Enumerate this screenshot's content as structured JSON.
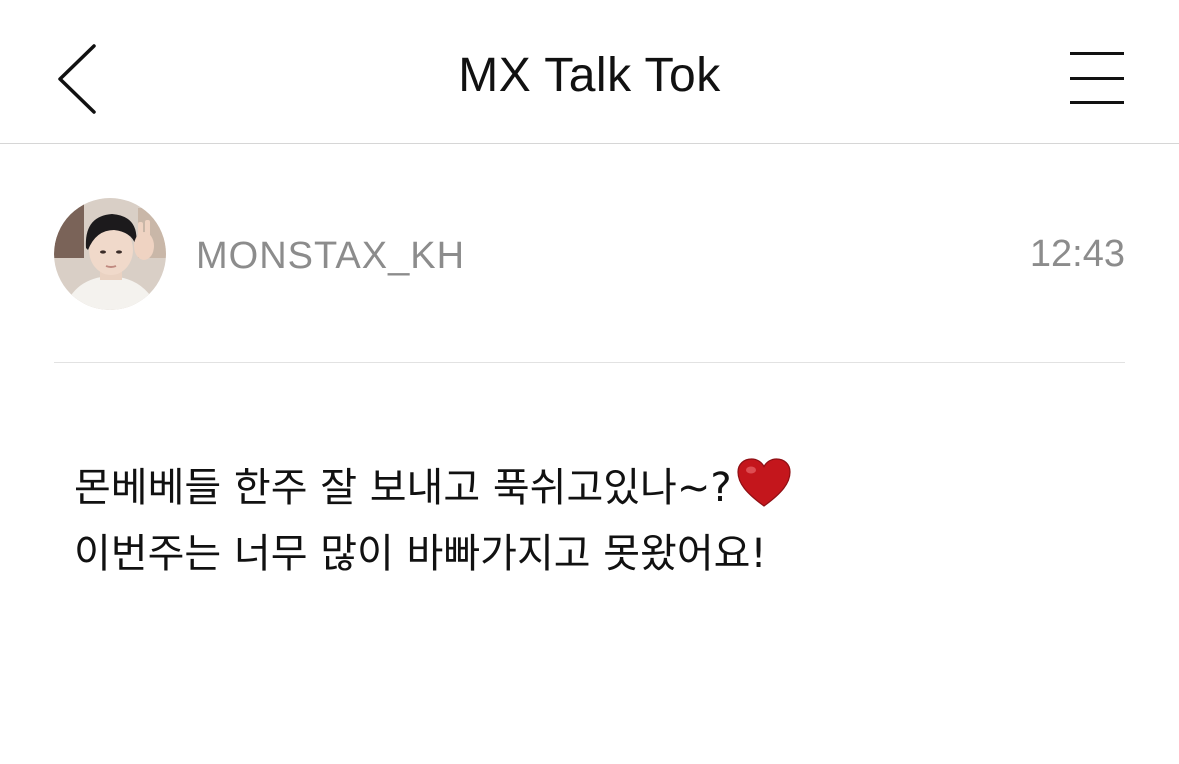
{
  "header": {
    "title": "MX Talk Tok",
    "back_icon": "chevron-left-icon",
    "menu_icon": "hamburger-menu-icon"
  },
  "post": {
    "author": "MONSTAX_KH",
    "time": "12:43",
    "avatar_icon": "profile-photo",
    "lines": [
      "몬베베들 한주 잘 보내고 푹쉬고있나~?",
      "이번주는 너무 많이 바빠가지고 못왔어요!"
    ],
    "emoji": "heart-emoji",
    "heart_color": "#c4161c"
  },
  "colors": {
    "text": "#111111",
    "muted": "#8c8c8c",
    "divider": "#e2e2e2"
  }
}
